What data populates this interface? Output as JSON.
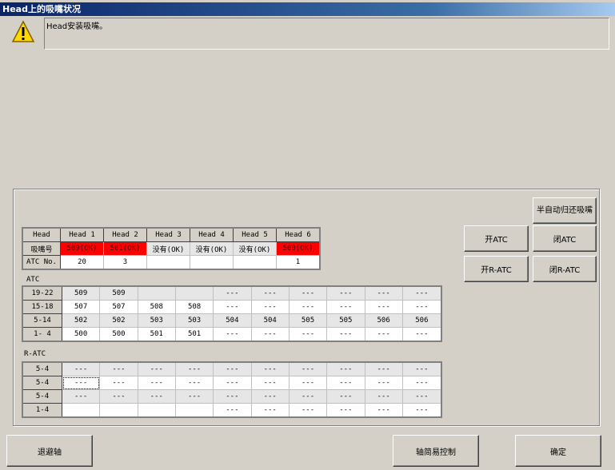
{
  "window": {
    "title": "Head上的吸嘴状况"
  },
  "message": "Head安装吸嘴。",
  "head_table": {
    "headers": [
      "Head",
      "Head 1",
      "Head 2",
      "Head 3",
      "Head 4",
      "Head 5",
      "Head 6"
    ],
    "rows": [
      {
        "label": "吸嘴号",
        "cells": [
          "509(OK)",
          "501(OK)",
          "没有(OK)",
          "没有(OK)",
          "没有(OK)",
          "500(OK)"
        ],
        "red": [
          true,
          true,
          false,
          false,
          false,
          true
        ]
      },
      {
        "label": "ATC No.",
        "cells": [
          "20",
          "3",
          "",
          "",
          "",
          "1"
        ],
        "red": [
          false,
          false,
          false,
          false,
          false,
          false
        ]
      }
    ]
  },
  "atc": {
    "label": "ATC",
    "rows": [
      {
        "label": "19-22",
        "cells": [
          "509",
          "509",
          "",
          "",
          "---",
          "---",
          "---",
          "---",
          "---",
          "---"
        ]
      },
      {
        "label": "15-18",
        "cells": [
          "507",
          "507",
          "508",
          "508",
          "---",
          "---",
          "---",
          "---",
          "---",
          "---"
        ]
      },
      {
        "label": "5-14",
        "cells": [
          "502",
          "502",
          "503",
          "503",
          "504",
          "504",
          "505",
          "505",
          "506",
          "506"
        ]
      },
      {
        "label": "1- 4",
        "cells": [
          "500",
          "500",
          "501",
          "501",
          "---",
          "---",
          "---",
          "---",
          "---",
          "---"
        ]
      }
    ]
  },
  "ratc": {
    "label": "R-ATC",
    "rows": [
      {
        "label": "5-4",
        "cells": [
          "---",
          "---",
          "---",
          "---",
          "---",
          "---",
          "---",
          "---",
          "---",
          "---"
        ]
      },
      {
        "label": "5-4",
        "cells": [
          "---",
          "---",
          "---",
          "---",
          "---",
          "---",
          "---",
          "---",
          "---",
          "---"
        ]
      },
      {
        "label": "5-4",
        "cells": [
          "---",
          "---",
          "---",
          "---",
          "---",
          "---",
          "---",
          "---",
          "---",
          "---"
        ]
      },
      {
        "label": "1-4",
        "cells": [
          "",
          "",
          "",
          "",
          "---",
          "---",
          "---",
          "---",
          "---",
          "---"
        ]
      }
    ]
  },
  "buttons": {
    "semi_auto_return": "半自动归还吸嘴",
    "open_atc": "开ATC",
    "close_atc": "闭ATC",
    "open_ratc": "开R-ATC",
    "close_ratc": "闭R-ATC",
    "retract_axis": "退避轴",
    "axis_simple_control": "轴简易控制",
    "ok": "确定"
  }
}
